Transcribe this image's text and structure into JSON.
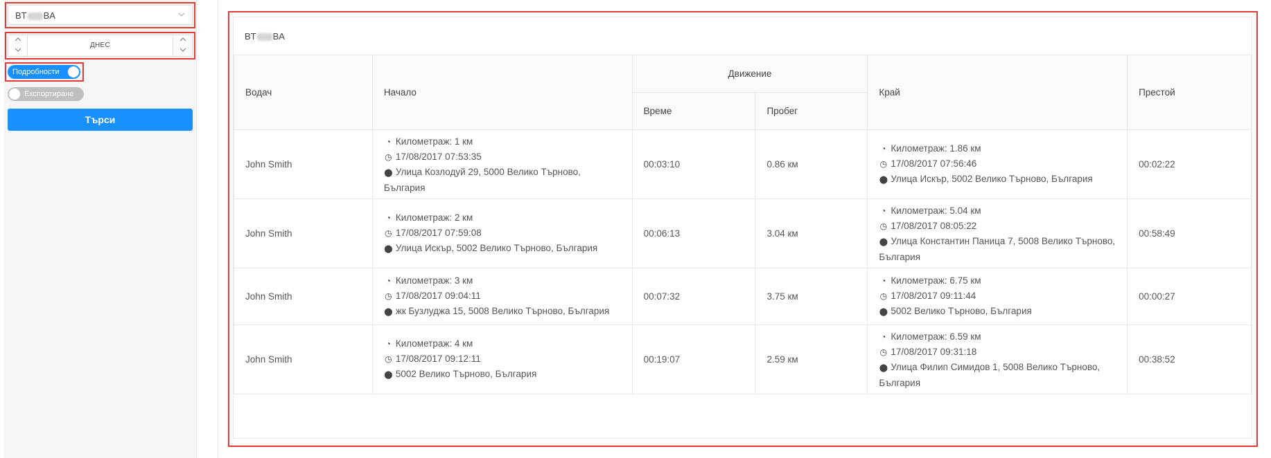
{
  "sidebar": {
    "vehicle_select": {
      "prefix": "BT",
      "suffix": "BA",
      "chevron": "chevron-down-icon"
    },
    "date_picker": {
      "label": "ДНЕС",
      "up": "▲",
      "down": "▼"
    },
    "details_toggle": {
      "label": "Подробности",
      "checked": true
    },
    "export_toggle": {
      "label": "Експортиране",
      "checked": false
    },
    "search_button": "Търси",
    "accent_color": "#1890ff",
    "highlight_color": "#e53935"
  },
  "panel": {
    "title_prefix": "BT",
    "title_suffix": "BA",
    "table": {
      "headers": {
        "driver": "Водач",
        "start": "Начало",
        "movement": "Движение",
        "time": "Време",
        "distance": "Пробег",
        "end": "Край",
        "idle": "Престой"
      },
      "rows": [
        {
          "driver": "John Smith",
          "start": {
            "odometer": "Километраж: 1 км",
            "datetime": "17/08/2017 07:53:35",
            "address": "Улица Козлодуй 29, 5000 Велико Търново, България"
          },
          "time": "00:03:10",
          "distance": "0.86 км",
          "end": {
            "odometer": "Километраж: 1.86 км",
            "datetime": "17/08/2017 07:56:46",
            "address": "Улица Искър, 5002 Велико Търново, България"
          },
          "idle": "00:02:22"
        },
        {
          "driver": "John Smith",
          "start": {
            "odometer": "Километраж: 2 км",
            "datetime": "17/08/2017 07:59:08",
            "address": "Улица Искър, 5002 Велико Търново, България"
          },
          "time": "00:06:13",
          "distance": "3.04 км",
          "end": {
            "odometer": "Километраж: 5.04 км",
            "datetime": "17/08/2017 08:05:22",
            "address": "Улица Константин Паница 7, 5008 Велико Търново, България"
          },
          "idle": "00:58:49"
        },
        {
          "driver": "John Smith",
          "start": {
            "odometer": "Километраж: 3 км",
            "datetime": "17/08/2017 09:04:11",
            "address": "жк Бузлуджа 15, 5008 Велико Търново, България"
          },
          "time": "00:07:32",
          "distance": "3.75 км",
          "end": {
            "odometer": "Километраж: 6.75 км",
            "datetime": "17/08/2017 09:11:44",
            "address": "5002 Велико Търново, България"
          },
          "idle": "00:00:27"
        },
        {
          "driver": "John Smith",
          "start": {
            "odometer": "Километраж: 4 км",
            "datetime": "17/08/2017 09:12:11",
            "address": "5002 Велико Търново, България"
          },
          "time": "00:19:07",
          "distance": "2.59 км",
          "end": {
            "odometer": "Километраж: 6.59 км",
            "datetime": "17/08/2017 09:31:18",
            "address": "Улица Филип Симидов 1, 5008 Велико Търново, България"
          },
          "idle": "00:38:52"
        }
      ]
    }
  }
}
